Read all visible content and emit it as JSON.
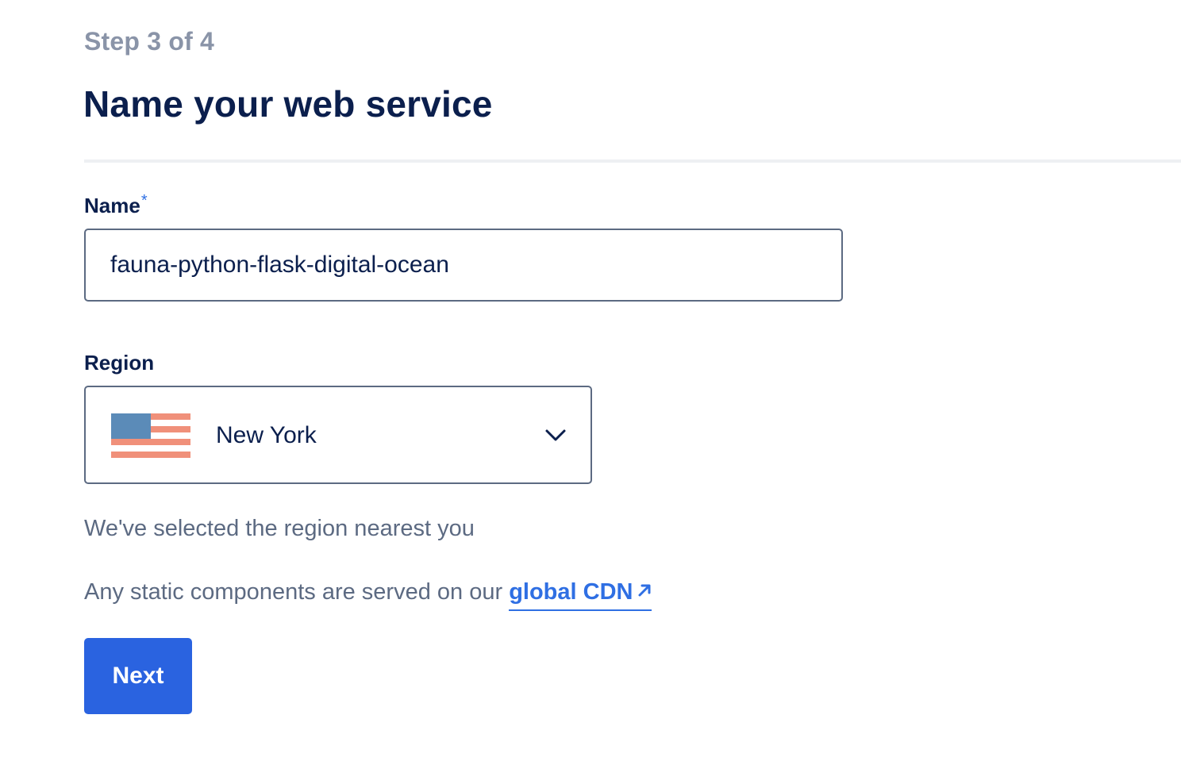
{
  "step": {
    "label": "Step 3 of 4"
  },
  "page": {
    "title": "Name your web service"
  },
  "name_field": {
    "label": "Name",
    "required_marker": "*",
    "value": "fauna-python-flask-digital-ocean"
  },
  "region_field": {
    "label": "Region",
    "selected": "New York",
    "flag_icon": "us-flag-icon",
    "dropdown_icon": "chevron-down-icon"
  },
  "hints": {
    "region_note": "We've selected the region nearest you",
    "cdn_prefix": "Any static components are served on our",
    "cdn_link": "global CDN",
    "cdn_link_icon": "external-arrow-icon"
  },
  "actions": {
    "next_label": "Next"
  },
  "colors": {
    "heading": "#0b1f4d",
    "muted": "#8a94a8",
    "body_text": "#5c6a82",
    "accent": "#2f6fe3",
    "button_bg": "#2a63e0",
    "flag_blue": "#5b8bb8",
    "flag_stripe": "#f0907a"
  }
}
